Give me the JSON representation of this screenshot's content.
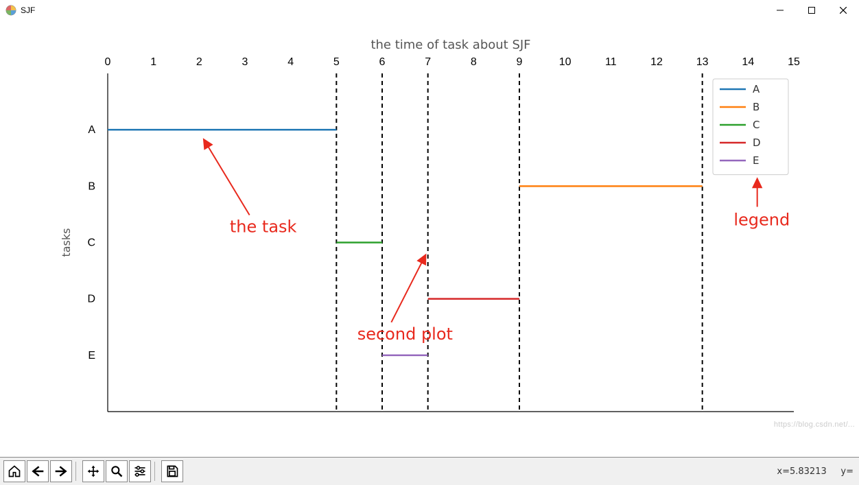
{
  "window": {
    "title": "SJF",
    "status_x_label": "x=",
    "status_x_value": "5.83213",
    "status_y_label": "y="
  },
  "toolbar": {
    "home": "home-icon",
    "back": "back-icon",
    "forward": "forward-icon",
    "pan": "pan-icon",
    "zoom": "zoom-icon",
    "configure": "configure-icon",
    "save": "save-icon"
  },
  "watermark": "https://blog.csdn.net/...",
  "chart_data": {
    "type": "line",
    "title": "the time of task about SJF",
    "xlabel": "",
    "ylabel": "tasks",
    "xlim": [
      0,
      15
    ],
    "xticks": [
      0,
      1,
      2,
      3,
      4,
      5,
      6,
      7,
      8,
      9,
      10,
      11,
      12,
      13,
      14,
      15
    ],
    "y_categories": [
      "A",
      "B",
      "C",
      "D",
      "E"
    ],
    "series": [
      {
        "name": "A",
        "color": "#1f77b4",
        "segments": [
          {
            "x0": 0,
            "x1": 5,
            "y": "A"
          }
        ]
      },
      {
        "name": "B",
        "color": "#ff7f0e",
        "segments": [
          {
            "x0": 9,
            "x1": 13,
            "y": "B"
          }
        ]
      },
      {
        "name": "C",
        "color": "#2ca02c",
        "segments": [
          {
            "x0": 5,
            "x1": 6,
            "y": "C"
          }
        ]
      },
      {
        "name": "D",
        "color": "#d62728",
        "segments": [
          {
            "x0": 7,
            "x1": 9,
            "y": "D"
          }
        ]
      },
      {
        "name": "E",
        "color": "#9467bd",
        "segments": [
          {
            "x0": 6,
            "x1": 7,
            "y": "E"
          }
        ]
      }
    ],
    "vertical_guides": [
      5,
      6,
      7,
      9,
      13
    ],
    "legend": {
      "position": "upper-right",
      "entries": [
        "A",
        "B",
        "C",
        "D",
        "E"
      ]
    },
    "annotations": [
      {
        "text": "the task",
        "color": "#e8291d",
        "target": "series A near x=2"
      },
      {
        "text": "second plot",
        "color": "#e8291d",
        "target": "vertical guide at x=7"
      },
      {
        "text": "legend",
        "color": "#e8291d",
        "target": "legend box"
      }
    ]
  }
}
